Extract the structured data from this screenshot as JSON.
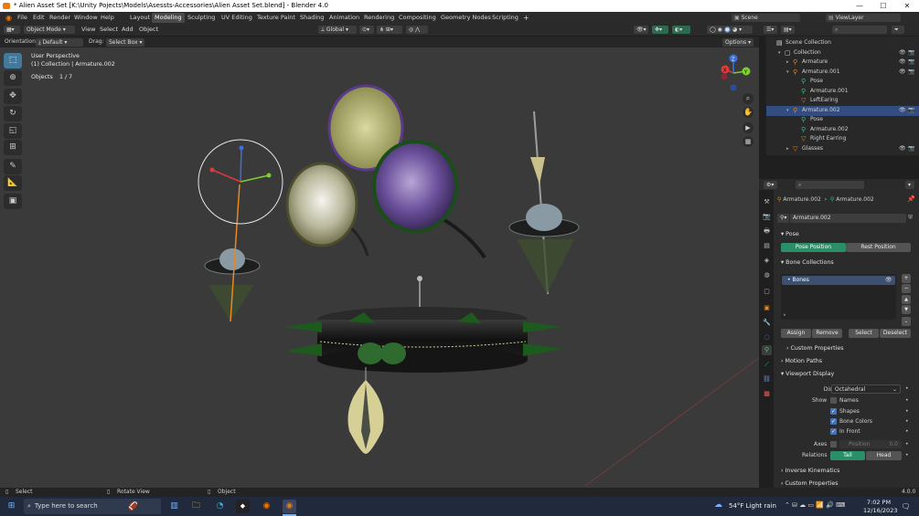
{
  "window": {
    "title": "* Alien Asset Set [K:\\Unity Pojects\\Models\\Asessts-Accessories\\Alien Asset Set.blend] - Blender 4.0",
    "minimize": "—",
    "maximize": "☐",
    "close": "✕"
  },
  "menu": [
    "File",
    "Edit",
    "Render",
    "Window",
    "Help"
  ],
  "workspaces": [
    "Layout",
    "Modeling",
    "Sculpting",
    "UV Editing",
    "Texture Paint",
    "Shading",
    "Animation",
    "Rendering",
    "Compositing",
    "Geometry Nodes",
    "Scripting",
    "+"
  ],
  "active_workspace": "Modeling",
  "scene": {
    "name": "Scene",
    "view_layer": "ViewLayer"
  },
  "viewport_header": {
    "mode": "Object Mode",
    "menus": [
      "View",
      "Select",
      "Add",
      "Object"
    ],
    "transform": "Global",
    "orientation_label": "Orientation:",
    "orientation_value": "Default",
    "drag_label": "Drag:",
    "drag_value": "Select Box",
    "options": "Options"
  },
  "viewport_overlay": {
    "perspective": "User Perspective",
    "collection": "(1) Collection | Armature.002",
    "objects_label": "Objects",
    "objects_value": "1 / 7"
  },
  "gizmo": {
    "x": "X",
    "y": "Y",
    "z": "Z"
  },
  "outliner": {
    "search_placeholder": "",
    "rows": [
      {
        "label": "Scene Collection",
        "depth": 0,
        "icon": "scene-collection-icon"
      },
      {
        "label": "Collection",
        "depth": 1,
        "icon": "collection-icon"
      },
      {
        "label": "Armature",
        "depth": 2,
        "icon": "armature-icon"
      },
      {
        "label": "Armature.001",
        "depth": 2,
        "icon": "armature-icon"
      },
      {
        "label": "Pose",
        "depth": 3,
        "icon": "pose-icon"
      },
      {
        "label": "Armature.001",
        "depth": 3,
        "icon": "armature-data-icon"
      },
      {
        "label": "LeftEaring",
        "depth": 3,
        "icon": "mesh-icon"
      },
      {
        "label": "Armature.002",
        "depth": 2,
        "icon": "armature-icon",
        "selected": true
      },
      {
        "label": "Pose",
        "depth": 3,
        "icon": "pose-icon"
      },
      {
        "label": "Armature.002",
        "depth": 3,
        "icon": "armature-data-icon"
      },
      {
        "label": "Right Earring",
        "depth": 3,
        "icon": "mesh-icon"
      },
      {
        "label": "Glasses",
        "depth": 2,
        "icon": "mesh-icon"
      }
    ]
  },
  "properties": {
    "breadcrumb_object": "Armature.002",
    "breadcrumb_data": "Armature.002",
    "datablock_name": "Armature.002",
    "pose_section": "Pose",
    "pose_position": "Pose Position",
    "rest_position": "Rest Position",
    "bone_collections_section": "Bone Collections",
    "bones_item": "Bones",
    "assign": "Assign",
    "remove": "Remove",
    "select": "Select",
    "deselect": "Deselect",
    "custom_properties_1": "Custom Properties",
    "motion_paths": "Motion Paths",
    "viewport_display": "Viewport Display",
    "display_as_label": "Display As",
    "display_as_value": "Octahedral",
    "show_label": "Show",
    "show_names": "Names",
    "show_shapes": "Shapes",
    "show_bone_colors": "Bone Colors",
    "show_in_front": "In Front",
    "axes_label": "Axes",
    "axes_position_label": "Position",
    "axes_position_value": "0.0",
    "relations_label": "Relations",
    "relations_tail": "Tail",
    "relations_head": "Head",
    "inverse_kinematics": "Inverse Kinematics",
    "custom_properties_2": "Custom Properties"
  },
  "statusbar": {
    "select": "Select",
    "rotate_view": "Rotate View",
    "object": "Object",
    "version": "4.0.0"
  },
  "taskbar": {
    "search_placeholder": "Type here to search",
    "weather": "54°F  Light rain",
    "time": "7:02 PM",
    "date": "12/16/2023"
  },
  "colors": {
    "accent_blue": "#4772b3",
    "selected_row": "#334d80",
    "teal_button": "#2a8f68",
    "viewport_bg": "#3a3a3a"
  }
}
